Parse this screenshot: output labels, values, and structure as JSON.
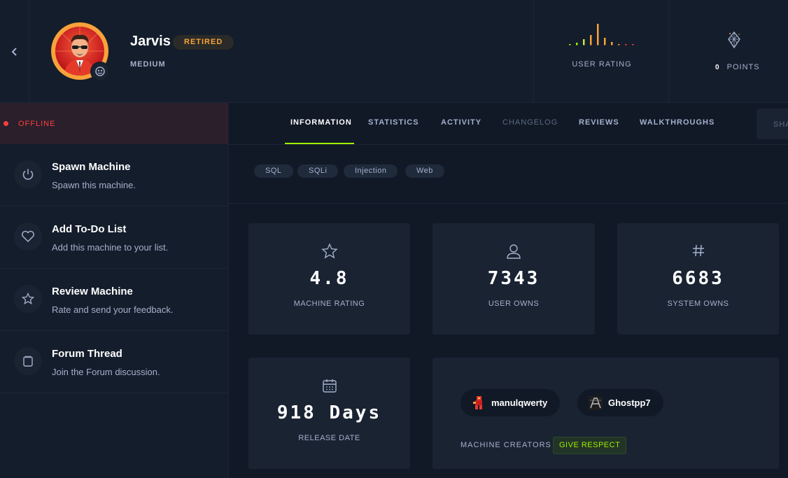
{
  "machine": {
    "name": "Jarvis",
    "status_badge": "RETIRED",
    "difficulty": "MEDIUM"
  },
  "rating": {
    "label": "USER RATING"
  },
  "points": {
    "value": "0",
    "label": "POINTS"
  },
  "sidebar": {
    "status": "OFFLINE",
    "actions": [
      {
        "title": "Spawn Machine",
        "subtitle": "Spawn this machine.",
        "icon": "power-icon"
      },
      {
        "title": "Add To-Do List",
        "subtitle": "Add this machine to your list.",
        "icon": "heart-icon"
      },
      {
        "title": "Review Machine",
        "subtitle": "Rate and send your feedback.",
        "icon": "star-icon"
      },
      {
        "title": "Forum Thread",
        "subtitle": "Join the Forum discussion.",
        "icon": "notepad-icon"
      }
    ]
  },
  "tabs": [
    {
      "label": "INFORMATION",
      "active": true
    },
    {
      "label": "STATISTICS"
    },
    {
      "label": "ACTIVITY"
    },
    {
      "label": "CHANGELOG",
      "disabled": true
    },
    {
      "label": "REVIEWS"
    },
    {
      "label": "WALKTHROUGHS"
    }
  ],
  "share_label": "SHA",
  "tags": [
    "SQL",
    "SQLi",
    "Injection",
    "Web"
  ],
  "stats": {
    "rating": {
      "value": "4.8",
      "label": "MACHINE RATING"
    },
    "user_owns": {
      "value": "7343",
      "label": "USER OWNS"
    },
    "system_owns": {
      "value": "6683",
      "label": "SYSTEM OWNS"
    },
    "release": {
      "value": "918 Days",
      "label": "RELEASE DATE"
    }
  },
  "creators": {
    "list": [
      "manulqwerty",
      "Ghostpp7"
    ],
    "label": "MACHINE CREATORS",
    "respect_button": "GIVE RESPECT"
  },
  "colors": {
    "accent_green": "#9fef00",
    "retired_orange": "#f7a23a",
    "offline_red": "#ff3e3e",
    "background": "#111927",
    "card": "#1a2332"
  }
}
